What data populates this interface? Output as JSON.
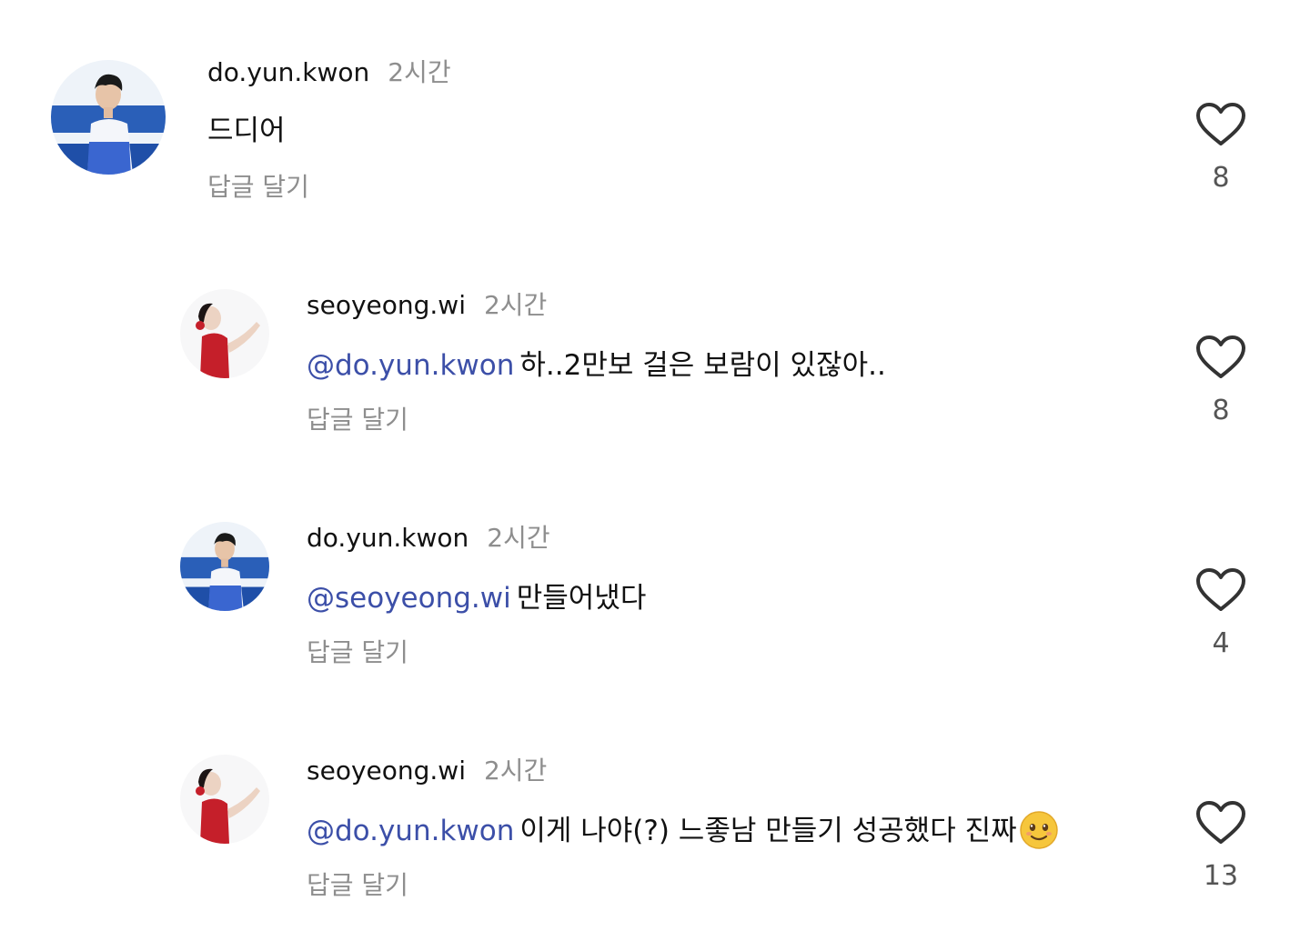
{
  "comments": [
    {
      "username": "do.yun.kwon",
      "time": "2시간",
      "mention": "",
      "text": "드디어",
      "reply_label": "답글 달기",
      "likes": "8",
      "avatar": "male-athlete-avatar"
    },
    {
      "username": "seoyeong.wi",
      "time": "2시간",
      "mention": "@do.yun.kwon",
      "text": "하..2만보 걸은 보람이 있잖아..",
      "reply_label": "답글 달기",
      "likes": "8",
      "avatar": "female-dancer-avatar"
    },
    {
      "username": "do.yun.kwon",
      "time": "2시간",
      "mention": "@seoyeong.wi",
      "text": "만들어냈다",
      "reply_label": "답글 달기",
      "likes": "4",
      "avatar": "male-athlete-avatar"
    },
    {
      "username": "seoyeong.wi",
      "time": "2시간",
      "mention": "@do.yun.kwon",
      "text": "이게 나야(?) 느좋남 만들기 성공했다 진짜",
      "emoji": "smiling-face-with-tear-emoji",
      "reply_label": "답글 달기",
      "likes": "13",
      "avatar": "female-dancer-avatar"
    }
  ],
  "colors": {
    "mention": "#3c4fa8",
    "secondary_text": "#8e8e8e",
    "primary_text": "#111111",
    "heart_stroke": "#333333"
  },
  "icons": {
    "like": "heart-outline-icon"
  }
}
